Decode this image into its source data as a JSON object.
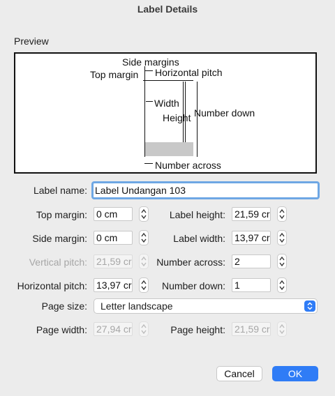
{
  "window": {
    "title": "Label Details"
  },
  "preview": {
    "section_label": "Preview",
    "side_margins": "Side margins",
    "top_margin": "Top margin",
    "horizontal_pitch": "Horizontal pitch",
    "width": "Width",
    "height": "Height",
    "number_down": "Number down",
    "number_across": "Number across"
  },
  "form": {
    "label_name": {
      "label": "Label name:",
      "value": "Label Undangan 103"
    },
    "top_margin": {
      "label": "Top margin:",
      "value": "0 cm"
    },
    "side_margin": {
      "label": "Side margin:",
      "value": "0 cm"
    },
    "vertical_pitch": {
      "label": "Vertical pitch:",
      "value": "21,59 cr"
    },
    "horizontal_pitch": {
      "label": "Horizontal pitch:",
      "value": "13,97 cr"
    },
    "label_height": {
      "label": "Label height:",
      "value": "21,59 cr"
    },
    "label_width": {
      "label": "Label width:",
      "value": "13,97 cr"
    },
    "number_across": {
      "label": "Number across:",
      "value": "2"
    },
    "number_down": {
      "label": "Number down:",
      "value": "1"
    },
    "page_size": {
      "label": "Page size:",
      "value": "Letter landscape"
    },
    "page_width": {
      "label": "Page width:",
      "value": "27,94 cr"
    },
    "page_height": {
      "label": "Page height:",
      "value": "21,59 cr"
    }
  },
  "buttons": {
    "cancel": "Cancel",
    "ok": "OK"
  },
  "colors": {
    "accent": "#2f7cf6",
    "focus_ring": "#6ea7e4"
  }
}
